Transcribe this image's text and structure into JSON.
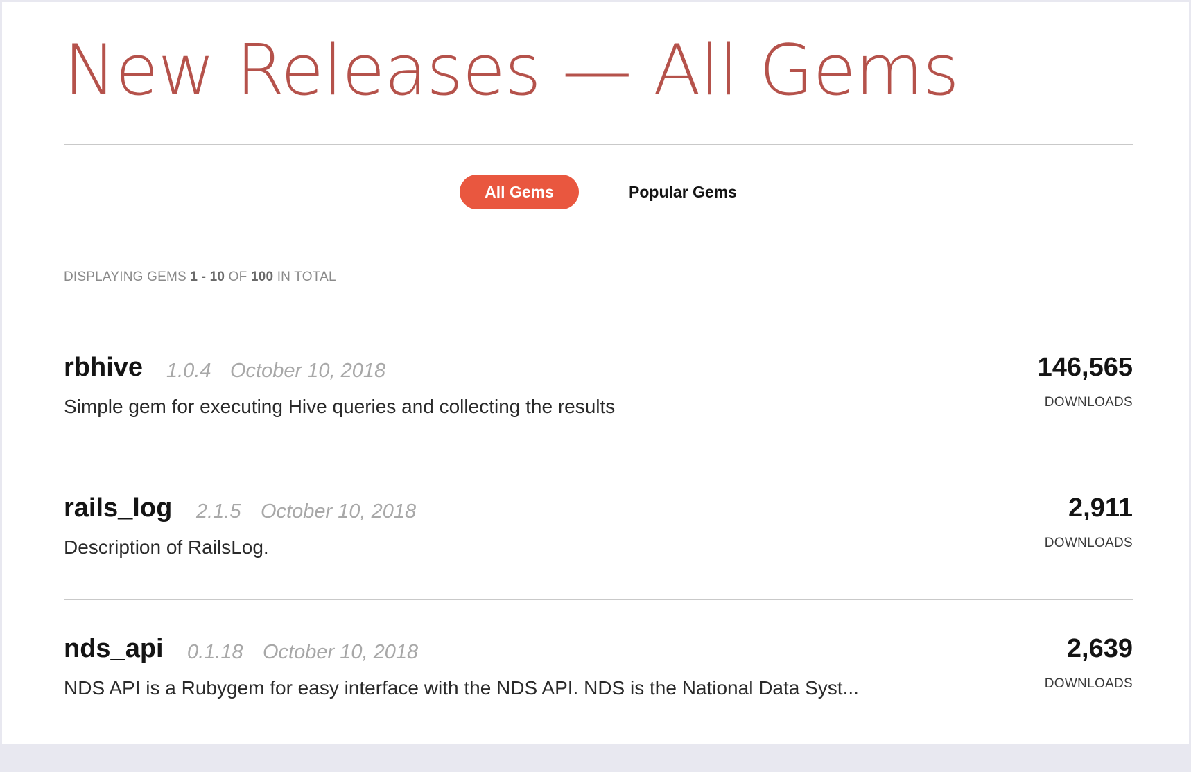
{
  "header": {
    "title": "New Releases — All Gems"
  },
  "tabs": [
    {
      "label": "All Gems",
      "active": true
    },
    {
      "label": "Popular Gems",
      "active": false
    }
  ],
  "summary": {
    "prefix": "DISPLAYING GEMS",
    "range": "1 - 10",
    "of": "OF",
    "total": "100",
    "suffix": "IN TOTAL"
  },
  "gems": [
    {
      "name": "rbhive",
      "version": "1.0.4",
      "date": "October 10, 2018",
      "description": "Simple gem for executing Hive queries and collecting the results",
      "downloads": "146,565",
      "downloads_label": "DOWNLOADS"
    },
    {
      "name": "rails_log",
      "version": "2.1.5",
      "date": "October 10, 2018",
      "description": "Description of RailsLog.",
      "downloads": "2,911",
      "downloads_label": "DOWNLOADS"
    },
    {
      "name": "nds_api",
      "version": "0.1.18",
      "date": "October 10, 2018",
      "description": "NDS API is a Rubygem for easy interface with the NDS API. NDS is the National Data Syst...",
      "downloads": "2,639",
      "downloads_label": "DOWNLOADS"
    }
  ],
  "colors": {
    "accent": "#e9573f",
    "title": "#b5524b"
  }
}
